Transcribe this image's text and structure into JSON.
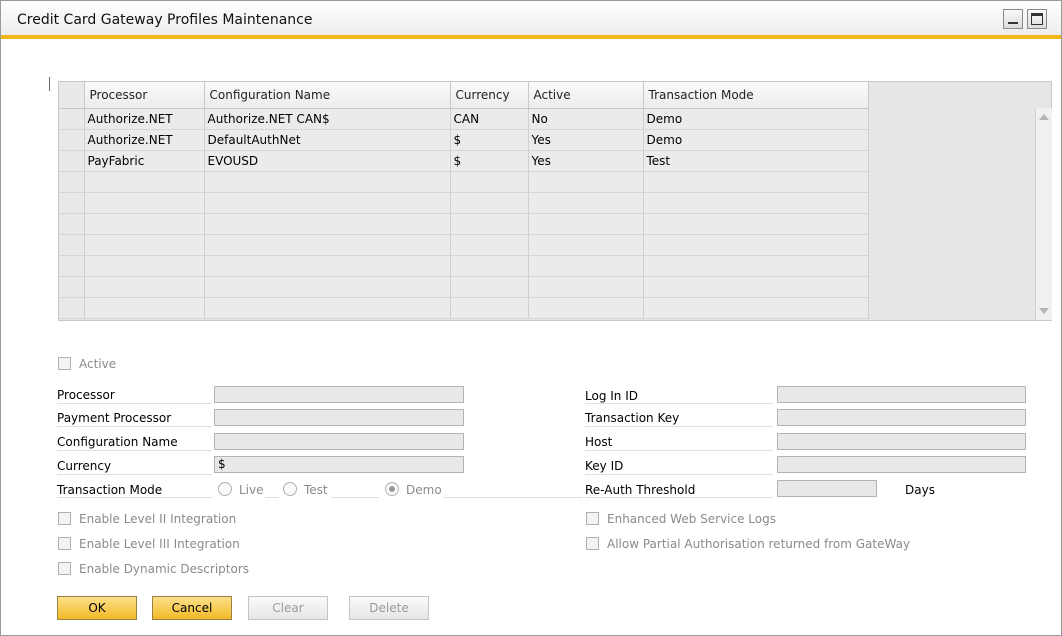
{
  "window": {
    "title": "Credit Card Gateway Profiles Maintenance"
  },
  "grid": {
    "columns": [
      "Processor",
      "Configuration Name",
      "Currency",
      "Active",
      "Transaction Mode"
    ],
    "rows": [
      [
        "Authorize.NET",
        "Authorize.NET CAN$",
        "CAN",
        "No",
        "Demo"
      ],
      [
        "Authorize.NET",
        "DefaultAuthNet",
        "$",
        "Yes",
        "Demo"
      ],
      [
        "PayFabric",
        "EVOUSD",
        "$",
        "Yes",
        "Test"
      ]
    ],
    "empty_rows": 7
  },
  "form": {
    "active_label": "Active",
    "processor_label": "Processor",
    "processor_value": "",
    "payment_processor_label": "Payment Processor",
    "payment_processor_value": "",
    "configuration_name_label": "Configuration Name",
    "configuration_name_value": "",
    "currency_label": "Currency",
    "currency_value": "$",
    "transaction_mode_label": "Transaction Mode",
    "modes": [
      "Live",
      "Test",
      "Demo"
    ],
    "selected_mode": "Demo",
    "login_id_label": "Log In ID",
    "transaction_key_label": "Transaction Key",
    "host_label": "Host",
    "key_id_label": "Key ID",
    "reauth_label": "Re-Auth Threshold",
    "days_label": "Days",
    "level2_label": "Enable Level II Integration",
    "level3_label": "Enable Level III Integration",
    "dynamic_descriptors_label": "Enable Dynamic Descriptors",
    "web_service_logs_label": "Enhanced Web Service Logs",
    "partial_auth_label": "Allow Partial Authorisation returned from GateWay"
  },
  "buttons": {
    "ok": "OK",
    "cancel": "Cancel",
    "clear": "Clear",
    "delete": "Delete"
  },
  "colors": {
    "accent": "#f3b619",
    "primary_button": "#f2b928"
  }
}
